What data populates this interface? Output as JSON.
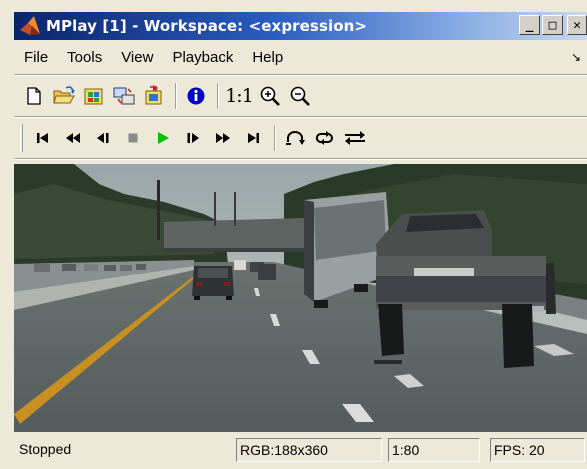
{
  "window": {
    "title": "MPlay [1] - Workspace: <expression>",
    "controls": {
      "minimize": "_",
      "maximize": "□",
      "close": "✕"
    }
  },
  "menu": {
    "items": [
      {
        "label": "File"
      },
      {
        "label": "Tools"
      },
      {
        "label": "View"
      },
      {
        "label": "Playback"
      },
      {
        "label": "Help"
      }
    ],
    "overflow_arrow": "↘"
  },
  "toolbar_main": {
    "buttons": [
      {
        "icon": "new-document-icon"
      },
      {
        "icon": "open-folder-icon"
      },
      {
        "icon": "import-icon"
      },
      {
        "icon": "connect-icon"
      },
      {
        "icon": "export-icon"
      },
      {
        "icon": "info-icon"
      },
      {
        "icon": "true-size-icon",
        "label": "1:1"
      },
      {
        "icon": "zoom-in-icon"
      },
      {
        "icon": "zoom-out-icon"
      }
    ]
  },
  "toolbar_playback": {
    "buttons": [
      {
        "icon": "go-to-first-icon"
      },
      {
        "icon": "rewind-icon"
      },
      {
        "icon": "step-back-icon"
      },
      {
        "icon": "stop-icon"
      },
      {
        "icon": "play-icon"
      },
      {
        "icon": "step-forward-icon"
      },
      {
        "icon": "fast-forward-icon"
      },
      {
        "icon": "go-to-last-icon"
      },
      {
        "icon": "jump-to-icon"
      },
      {
        "icon": "loop-icon"
      },
      {
        "icon": "forward-backward-icon"
      }
    ],
    "colors": {
      "play": "#00c000",
      "stop": "#8a8a8a",
      "icons": "#000000"
    }
  },
  "video": {
    "scene": "highway-driving-frame"
  },
  "status": {
    "state": "Stopped",
    "format": "RGB:188x360",
    "frame": "1:80",
    "fps": "FPS: 20"
  },
  "colors": {
    "title_bar_start": "#0a246a",
    "title_bar_end": "#c8d8f0",
    "window_bg": "#ece9d8",
    "info_blue": "#0000d0"
  }
}
